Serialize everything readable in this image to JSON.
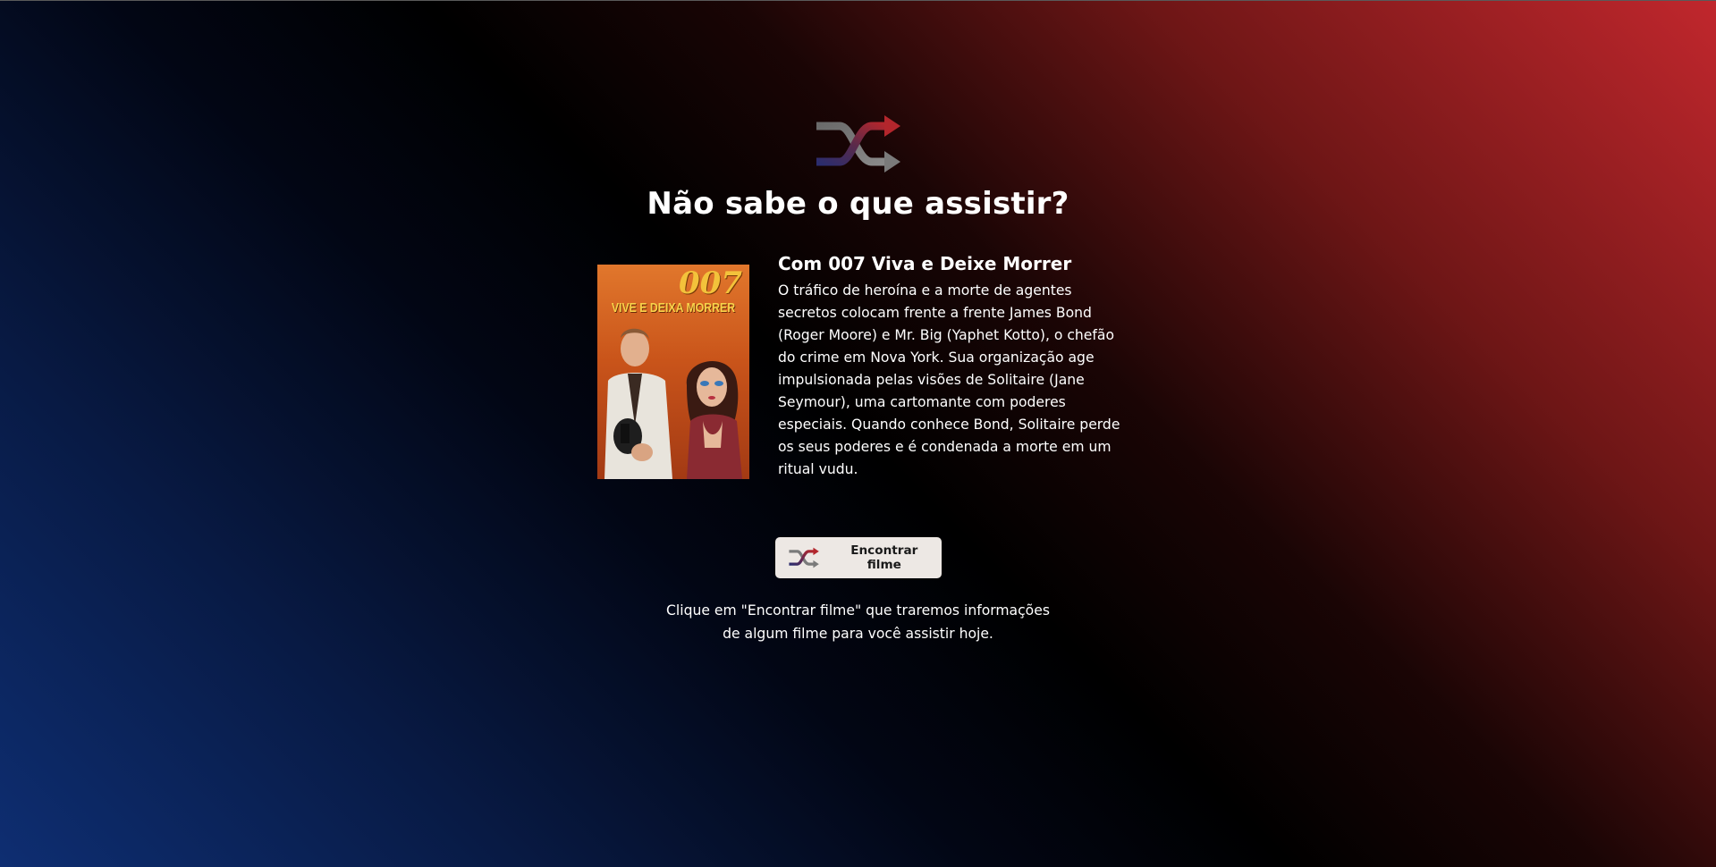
{
  "header": {
    "logo_icon": "shuffle-icon",
    "headline": "Não sabe o que assistir?"
  },
  "movie": {
    "poster": {
      "title_text": "007",
      "subtitle_text": "VIVE E DEIXA MORRER"
    },
    "title": "Com 007 Viva e Deixe Morrer",
    "description": "O tráfico de heroína e a morte de agentes secretos colocam frente a frente James Bond (Roger Moore) e Mr. Big (Yaphet Kotto), o chefão do crime em Nova York. Sua organização age impulsionada pelas visões de Solitaire (Jane Seymour), uma cartomante com poderes especiais. Quando conhece Bond, Solitaire perde os seus poderes e é condenada a morte em um ritual vudu."
  },
  "action": {
    "button_label": "Encontrar filme",
    "button_icon": "shuffle-icon"
  },
  "hint": {
    "line1": "Clique em \"Encontrar filme\" que traremos informações",
    "line2": "de algum filme para você assistir hoje."
  },
  "colors": {
    "accent_red": "#c1272d",
    "accent_blue": "#0e2e72",
    "button_bg": "#ede8e4"
  }
}
